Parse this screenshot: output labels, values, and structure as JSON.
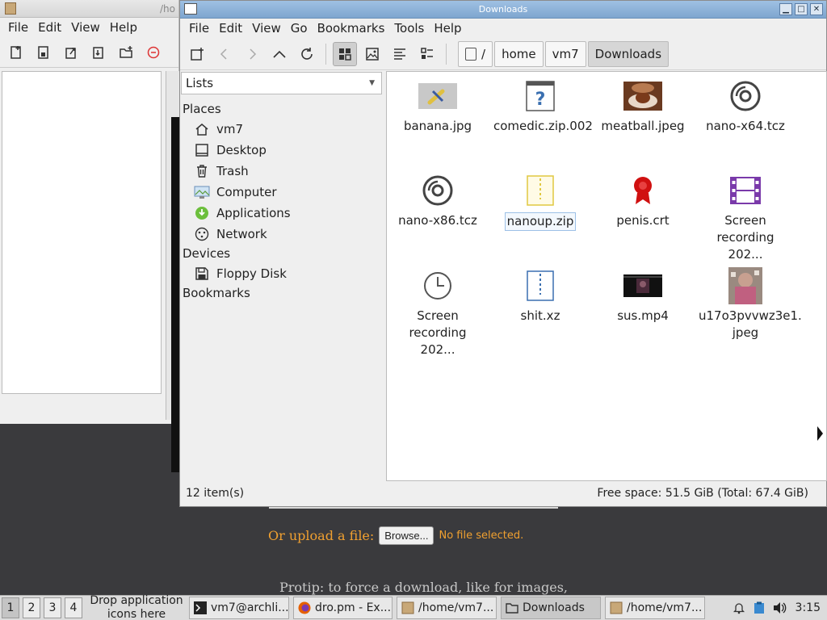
{
  "background_window": {
    "title": "/ho",
    "menu": [
      "File",
      "Edit",
      "View",
      "Help"
    ]
  },
  "web_page": {
    "upload_label": "Or upload a file:",
    "browse_button": "Browse...",
    "no_file_text": "No file selected.",
    "protip": "Protip: to force a download, like for images,"
  },
  "window": {
    "title": "Downloads",
    "minimize": "▁",
    "maximize": "□",
    "close": "✕"
  },
  "menu": {
    "file": "File",
    "edit": "Edit",
    "view": "View",
    "go": "Go",
    "bookmarks": "Bookmarks",
    "tools": "Tools",
    "help": "Help"
  },
  "breadcrumb": {
    "root": "/",
    "home": "home",
    "user": "vm7",
    "current": "Downloads"
  },
  "sidebar": {
    "selector_value": "Lists",
    "places_heading": "Places",
    "places": [
      {
        "label": "vm7",
        "icon": "home-icon"
      },
      {
        "label": "Desktop",
        "icon": "desktop-icon"
      },
      {
        "label": "Trash",
        "icon": "trash-icon"
      },
      {
        "label": "Computer",
        "icon": "computer-icon"
      },
      {
        "label": "Applications",
        "icon": "applications-icon"
      },
      {
        "label": "Network",
        "icon": "network-icon"
      }
    ],
    "devices_heading": "Devices",
    "devices": [
      {
        "label": "Floppy Disk",
        "icon": "floppy-icon"
      }
    ],
    "bookmarks_heading": "Bookmarks"
  },
  "files": [
    {
      "name": "banana.jpg",
      "icon": "image-thumbnail-icon"
    },
    {
      "name": "comedic.zip.002",
      "icon": "unknown-file-icon"
    },
    {
      "name": "meatball.jpeg",
      "icon": "image-thumbnail-icon"
    },
    {
      "name": "nano-x64.tcz",
      "icon": "disc-icon"
    },
    {
      "name": "nano-x86.tcz",
      "icon": "disc-icon"
    },
    {
      "name": "nanoup.zip",
      "icon": "zip-archive-icon",
      "selected": true
    },
    {
      "name": "penis.crt",
      "icon": "certificate-icon"
    },
    {
      "name_line1": "Screen",
      "name_line2": "recording 202...",
      "icon": "video-file-icon"
    },
    {
      "name_line1": "Screen",
      "name_line2": "recording 202...",
      "icon": "clock-icon"
    },
    {
      "name": "shit.xz",
      "icon": "xz-archive-icon"
    },
    {
      "name": "sus.mp4",
      "icon": "video-thumbnail-icon"
    },
    {
      "name_line1": "u17o3pvvwz3e1.",
      "name_line2": "jpeg",
      "icon": "image-thumbnail-icon"
    }
  ],
  "status": {
    "count": "12 item(s)",
    "free_space": "Free space: 51.5 GiB (Total: 67.4 GiB)"
  },
  "taskbar": {
    "workspaces": [
      "1",
      "2",
      "3",
      "4"
    ],
    "drop_hint_line1": "Drop application",
    "drop_hint_line2": "icons here",
    "tasks": [
      {
        "label": "vm7@archli...",
        "icon": "terminal-icon"
      },
      {
        "label": "dro.pm - Ex...",
        "icon": "firefox-icon"
      },
      {
        "label": "/home/vm7...",
        "icon": "file-manager-icon"
      },
      {
        "label": "Downloads",
        "icon": "folder-icon",
        "active": true
      },
      {
        "label": "/home/vm7...",
        "icon": "file-manager-icon"
      }
    ],
    "clock": "3:15"
  },
  "colors": {
    "titlebar": "#7ea5cf",
    "accent_orange": "#f0a030",
    "selection_border": "#9cc0e6"
  }
}
